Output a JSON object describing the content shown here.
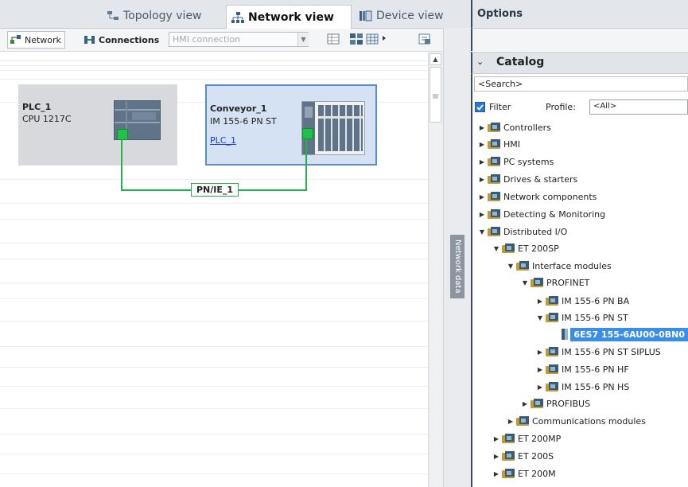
{
  "tabs": {
    "topology": "Topology view",
    "network": "Network view",
    "device": "Device view"
  },
  "toolbar": {
    "network_label": "Network",
    "connections_label": "Connections",
    "connection_type": "HMI connection"
  },
  "devices": [
    {
      "name": "PLC_1",
      "type": "CPU 1217C"
    },
    {
      "name": "Conveyor_1",
      "type": "IM 155-6 PN ST",
      "link": "PLC_1"
    }
  ],
  "subnet_label": "PN/IE_1",
  "side_tab": "Network data",
  "options": {
    "title": "Options"
  },
  "catalog": {
    "title": "Catalog",
    "search_value": "<Search>",
    "filter_label": "Filter",
    "profile_label": "Profile:",
    "profile_value": "<All>",
    "tree": [
      {
        "label": "Controllers",
        "expanded": false
      },
      {
        "label": "HMI",
        "expanded": false
      },
      {
        "label": "PC systems",
        "expanded": false
      },
      {
        "label": "Drives & starters",
        "expanded": false
      },
      {
        "label": "Network components",
        "expanded": false
      },
      {
        "label": "Detecting & Monitoring",
        "expanded": false
      },
      {
        "label": "Distributed I/O",
        "expanded": true
      },
      {
        "label": "ET 200SP",
        "expanded": true
      },
      {
        "label": "Interface modules",
        "expanded": true
      },
      {
        "label": "PROFINET",
        "expanded": true
      },
      {
        "label": "IM 155-6 PN BA",
        "expanded": false
      },
      {
        "label": "IM 155-6 PN ST",
        "expanded": true
      },
      {
        "label": "6ES7 155-6AU00-0BN0",
        "selected": true
      },
      {
        "label": "IM 155-6 PN ST SIPLUS",
        "expanded": false
      },
      {
        "label": "IM 155-6 PN HF",
        "expanded": false
      },
      {
        "label": "IM 155-6 PN HS",
        "expanded": false
      },
      {
        "label": "PROFIBUS",
        "expanded": false
      },
      {
        "label": "Communications modules",
        "expanded": false
      },
      {
        "label": "ET 200MP",
        "expanded": false
      },
      {
        "label": "ET 200S",
        "expanded": false
      },
      {
        "label": "ET 200M",
        "expanded": false
      }
    ]
  },
  "colors": {
    "accent": "#3d4a57",
    "link": "#1a3ccf",
    "ethernet": "#22b14c",
    "device_bg": "#d7d9dc",
    "device_selected_bg": "#d5e2f3",
    "selected_item": "#3b8ee8"
  }
}
